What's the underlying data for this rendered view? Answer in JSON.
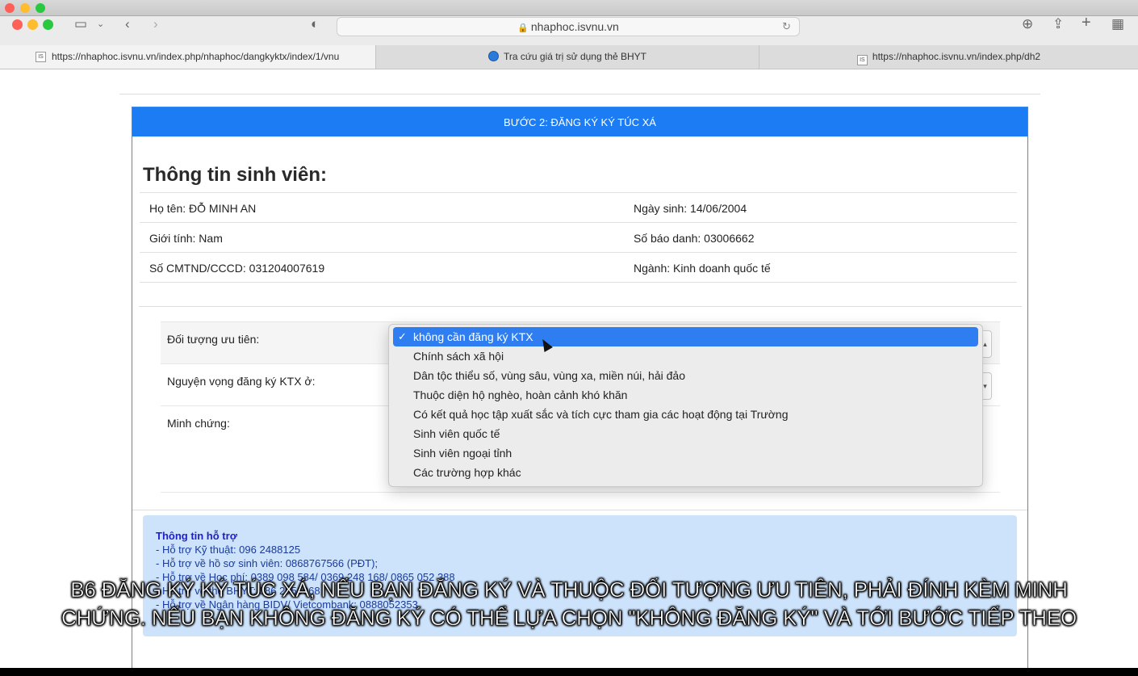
{
  "browser": {
    "url": "nhaphoc.isvnu.vn",
    "tabs": [
      {
        "label": "https://nhaphoc.isvnu.vn/index.php/nhaphoc/dangkyktx/index/1/vnu",
        "favicon": "IS"
      },
      {
        "label": "Tra cứu giá trị sử dụng thẻ BHYT",
        "favicon": "globe-icon"
      },
      {
        "label": "https://nhaphoc.isvnu.vn/index.php/dh2",
        "favicon": "IS"
      }
    ]
  },
  "card": {
    "header": "BƯỚC 2: ĐĂNG KÝ KÝ TÚC XÁ",
    "section_title": "Thông tin sinh viên:",
    "rows": [
      {
        "left": "Họ tên: ĐỖ MINH AN",
        "right": "Ngày sinh: 14/06/2004"
      },
      {
        "left": "Giới tính: Nam",
        "right": "Số báo danh: 03006662"
      },
      {
        "left": "Số CMTND/CCCD: 031204007619",
        "right": "Ngành: Kinh doanh quốc tế"
      }
    ]
  },
  "form": {
    "priority_label": "Đối tượng ưu tiên:",
    "wish_label": "Nguyện vọng đăng ký KTX ở:",
    "evidence_label": "Minh chứng:"
  },
  "dropdown": {
    "options": [
      "không cần đăng ký KTX",
      "Chính sách xã hội",
      "Dân tộc thiểu số, vùng sâu, vùng xa, miền núi, hải đảo",
      "Thuộc diện hộ nghèo, hoàn cảnh khó khăn",
      "Có kết quả học tập xuất sắc và tích cực tham gia các hoạt động tại Trường",
      "Sinh viên quốc tế",
      "Sinh viên ngoại tỉnh",
      "Các trường hợp khác"
    ],
    "selected_index": 0
  },
  "support": {
    "title": "Thông tin hỗ trợ",
    "lines": [
      "- Hỗ trợ Kỹ thuật: 096 2488125",
      "- Hỗ trợ về hồ sơ sinh viên: 0868767566 (PĐT);",
      "- Hỗ trợ về Học phí: 0389 098 584/ 0369 248 168/ 0865 052 388",
      "- Hỗ trợ về thẻ BHYT: 086 2956068",
      "- Hỗ trợ về Ngân hàng BIDV/ Vietcombank: 0888052353"
    ]
  },
  "caption": {
    "line1": "B6 ĐĂNG KÝ KÝ TÚC XÁ, NẾU BẠN ĐĂNG KÝ VÀ THUỘC ĐỐI TƯỢNG ƯU TIÊN, PHẢI ĐÍNH KÈM MINH",
    "line2": "CHỨNG. NẾU BẠN KHÔNG ĐĂNG KÝ CÓ THỂ LỰA CHỌN \"KHÔNG ĐĂNG KÝ\" VÀ TỚI BƯỚC TIẾP THEO"
  },
  "colors": {
    "header_blue": "#1b7cf3",
    "selected_blue": "#2f7ef1",
    "support_bg": "#cde3fb"
  }
}
